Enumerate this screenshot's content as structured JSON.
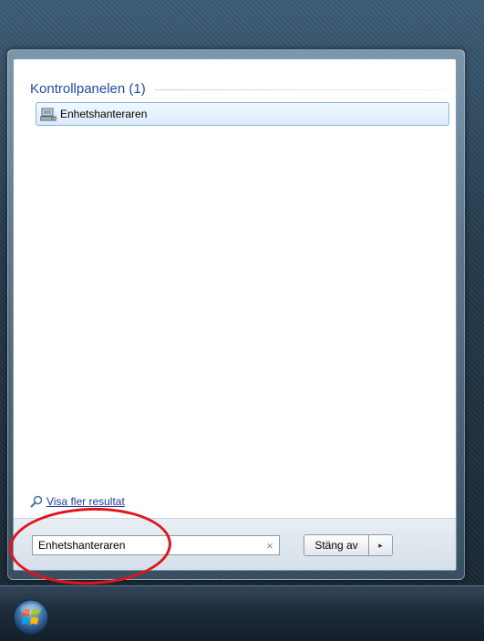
{
  "start_menu": {
    "group": {
      "title": "Kontrollpanelen (1)",
      "items": [
        {
          "label": "Enhetshanteraren",
          "icon": "device-manager-icon"
        }
      ]
    },
    "show_more": {
      "label": "Visa fler resultat",
      "icon": "search-icon"
    },
    "search": {
      "value": "Enhetshanteraren",
      "clear_icon": "×"
    },
    "shutdown": {
      "label": "Stäng av",
      "arrow": "▸"
    }
  },
  "taskbar": {
    "start_icon": "windows-orb-icon"
  },
  "colors": {
    "highlight_circle": "#e0161a",
    "group_title": "#1e4b9c",
    "selected_item_bg": "#dbeafb"
  }
}
